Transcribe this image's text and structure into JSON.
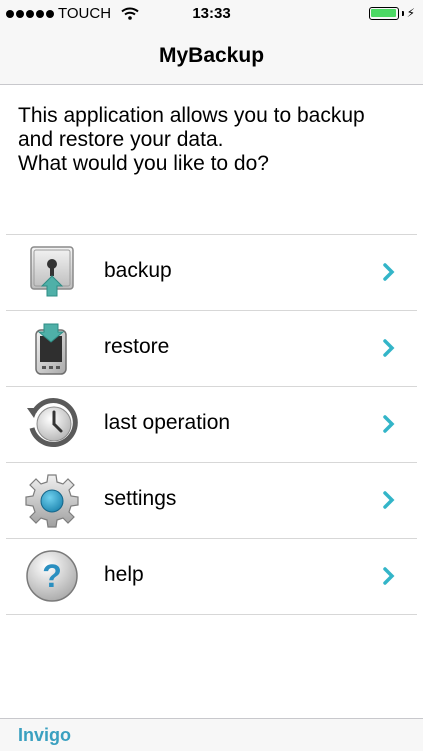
{
  "status_bar": {
    "carrier": "TOUCH",
    "time": "13:33",
    "signal_icon": "signal-dots-icon",
    "wifi_icon": "wifi-icon",
    "battery_icon": "battery-icon"
  },
  "nav": {
    "title": "MyBackup"
  },
  "intro": {
    "line1": "This application allows you to backup",
    "line2": "and restore your data.",
    "line3": "What would you like to do?"
  },
  "menu": {
    "items": [
      {
        "label": "backup",
        "icon": "backup-lock-icon"
      },
      {
        "label": "restore",
        "icon": "restore-phone-icon"
      },
      {
        "label": "last operation",
        "icon": "clock-history-icon"
      },
      {
        "label": "settings",
        "icon": "gear-icon"
      },
      {
        "label": "help",
        "icon": "question-icon"
      }
    ]
  },
  "footer": {
    "link": "Invigo"
  },
  "colors": {
    "accent": "#3aa0c0",
    "chevron": "#33b5c8",
    "battery": "#4cd964"
  }
}
